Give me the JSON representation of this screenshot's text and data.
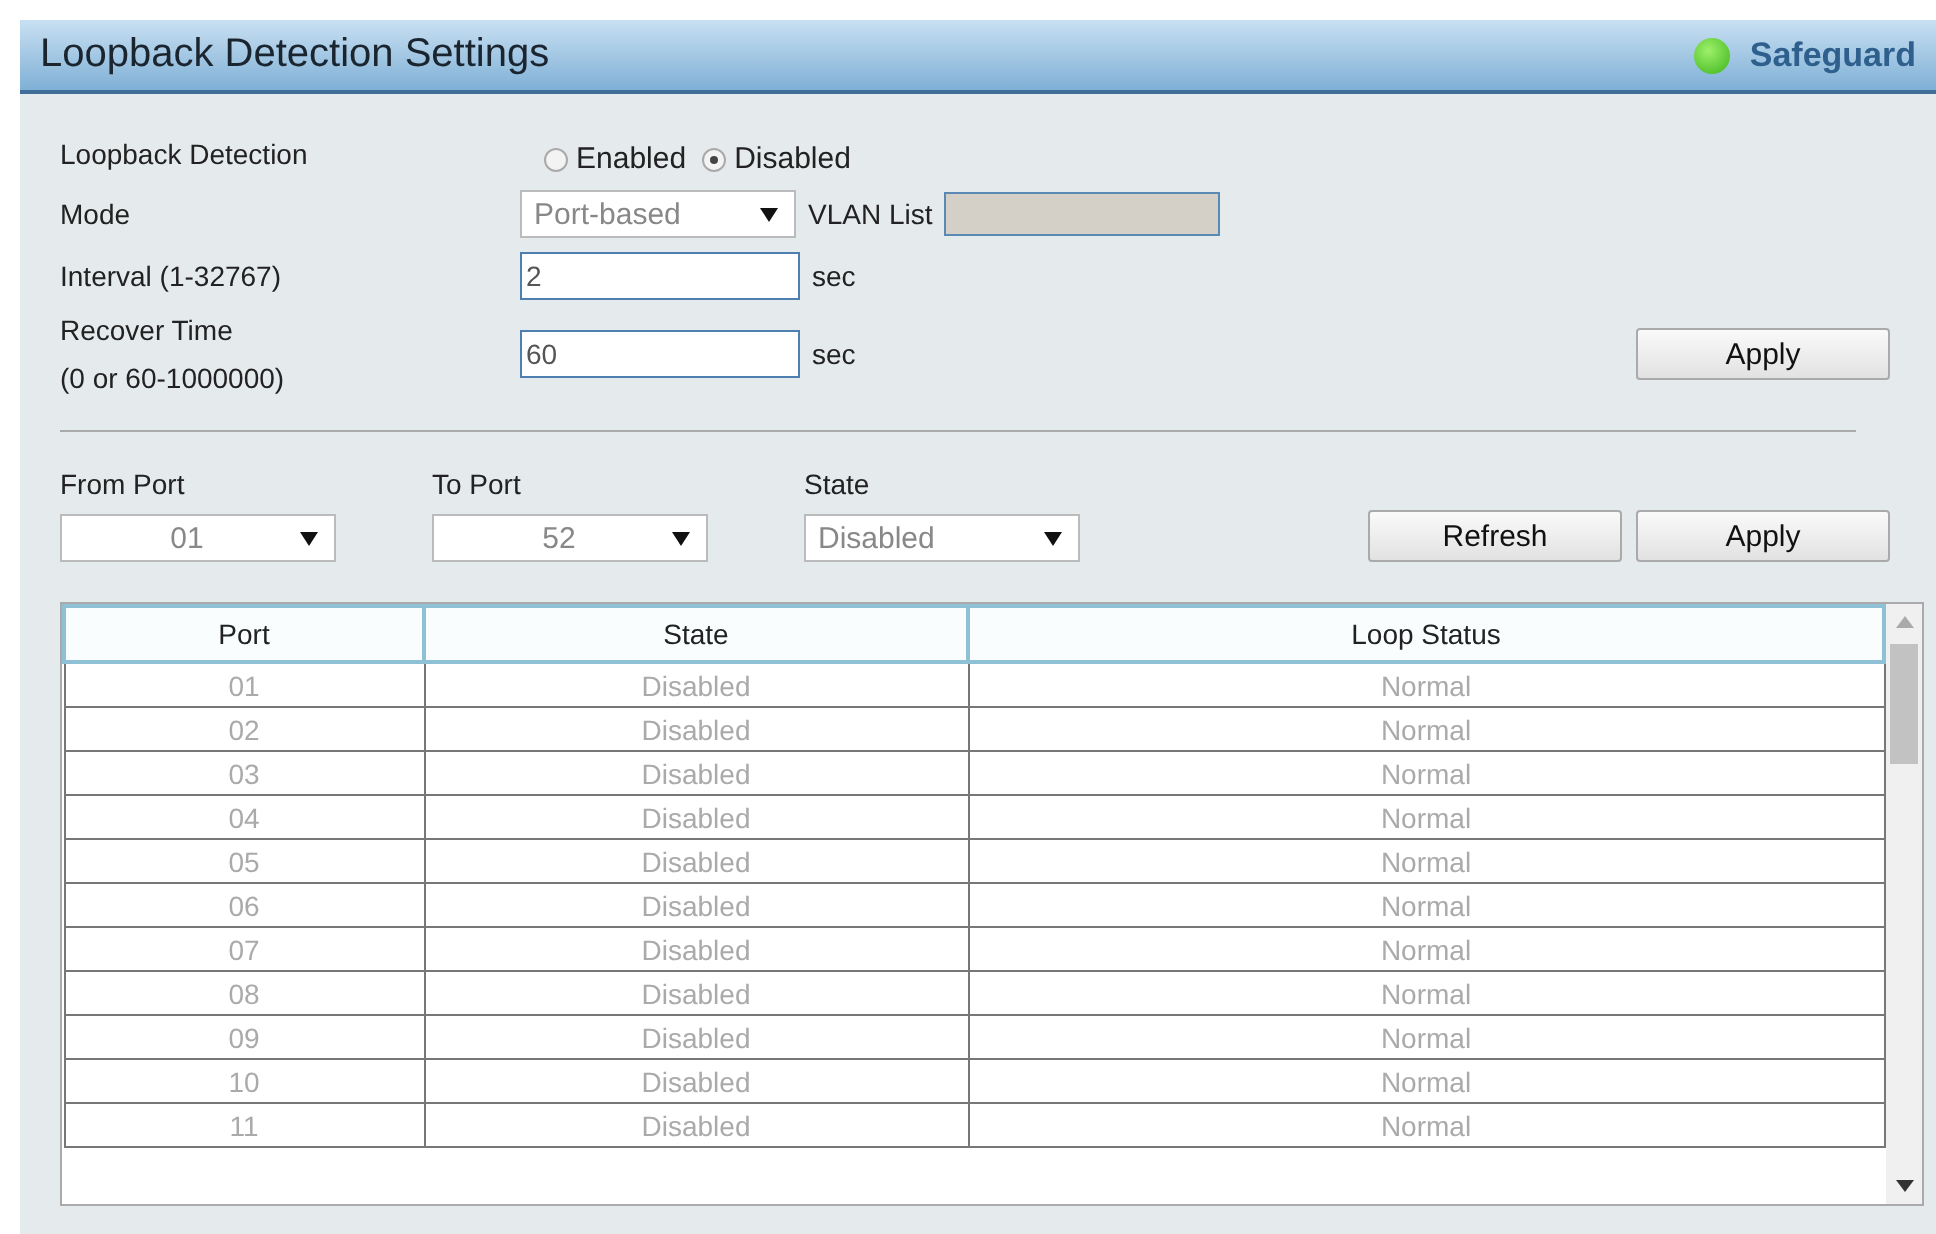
{
  "title": "Loopback Detection Settings",
  "badge": {
    "label": "Safeguard"
  },
  "loopback_detection": {
    "label": "Loopback Detection",
    "options": [
      {
        "label": "Enabled",
        "selected": false
      },
      {
        "label": "Disabled",
        "selected": true
      }
    ]
  },
  "mode": {
    "label": "Mode",
    "value": "Port-based",
    "vlan_label": "VLAN List",
    "vlan_disabled": true
  },
  "interval": {
    "label": "Interval (1-32767)",
    "value": "2",
    "unit": "sec"
  },
  "recover_time": {
    "label": "Recover Time",
    "hint": "(0 or 60-1000000)",
    "value": "60",
    "unit": "sec"
  },
  "settings_button": "Apply",
  "filters": [
    {
      "label": "From Port",
      "value": "01"
    },
    {
      "label": "To Port",
      "value": "52"
    },
    {
      "label": "State",
      "value": "Disabled"
    }
  ],
  "filter_buttons": [
    "Refresh",
    "Apply"
  ],
  "table": {
    "columns": [
      "Port",
      "State",
      "Loop Status"
    ],
    "rows": [
      [
        "01",
        "Disabled",
        "Normal"
      ],
      [
        "02",
        "Disabled",
        "Normal"
      ],
      [
        "03",
        "Disabled",
        "Normal"
      ],
      [
        "04",
        "Disabled",
        "Normal"
      ],
      [
        "05",
        "Disabled",
        "Normal"
      ],
      [
        "06",
        "Disabled",
        "Normal"
      ],
      [
        "07",
        "Disabled",
        "Normal"
      ],
      [
        "08",
        "Disabled",
        "Normal"
      ],
      [
        "09",
        "Disabled",
        "Normal"
      ],
      [
        "10",
        "Disabled",
        "Normal"
      ],
      [
        "11",
        "Disabled",
        "Normal"
      ]
    ]
  }
}
